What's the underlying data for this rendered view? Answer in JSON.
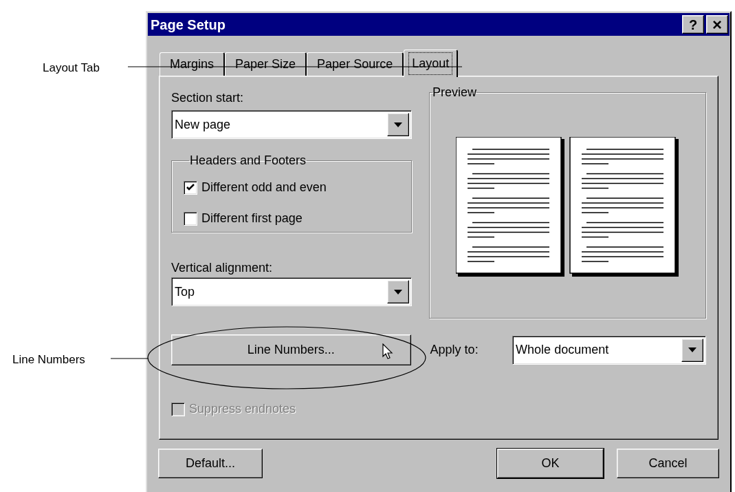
{
  "annotations": [
    {
      "label": "Layout Tab"
    },
    {
      "label": "Line Numbers"
    }
  ],
  "window": {
    "title": "Page Setup",
    "help_button": "?",
    "close_button": "×"
  },
  "tabs": [
    {
      "label": "Margins",
      "selected": false
    },
    {
      "label": "Paper Size",
      "selected": false
    },
    {
      "label": "Paper Source",
      "selected": false
    },
    {
      "label": "Layout",
      "selected": true
    }
  ],
  "section_start": {
    "label": "Section start:",
    "value": "New page"
  },
  "headers_footers": {
    "title": "Headers and Footers",
    "options": [
      {
        "label": "Different odd and even",
        "checked": true
      },
      {
        "label": "Different first page",
        "checked": false
      }
    ]
  },
  "vertical_alignment": {
    "label": "Vertical alignment:",
    "value": "Top"
  },
  "line_numbers_button": {
    "label": "Line Numbers..."
  },
  "preview": {
    "title": "Preview"
  },
  "apply_to": {
    "label": "Apply to:",
    "value": "Whole document"
  },
  "suppress_endnotes": {
    "label": "Suppress endnotes",
    "checked": false,
    "disabled": true
  },
  "buttons": [
    {
      "label": "Default...",
      "default": false
    },
    {
      "label": "OK",
      "default": true
    },
    {
      "label": "Cancel",
      "default": false
    }
  ]
}
